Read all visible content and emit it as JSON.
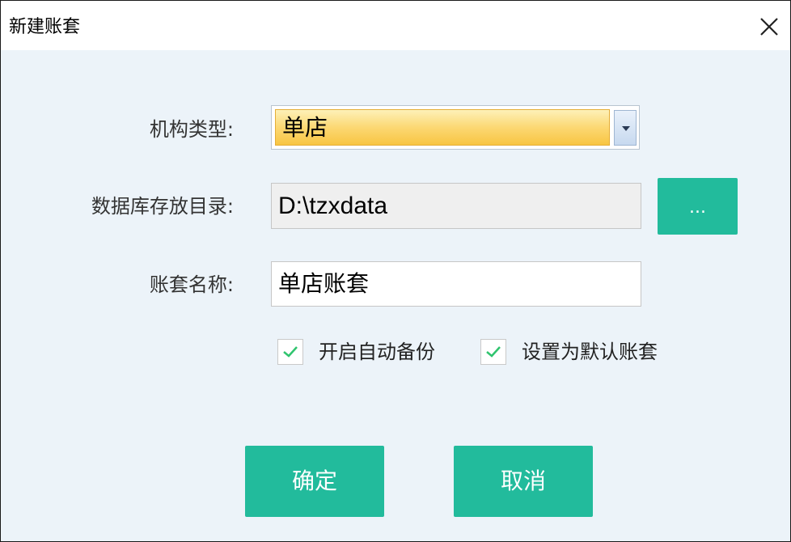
{
  "window": {
    "title": "新建账套",
    "close_icon": "close-icon"
  },
  "form": {
    "org_type": {
      "label": "机构类型:",
      "value": "单店"
    },
    "db_dir": {
      "label": "数据库存放目录:",
      "value": "D:\\tzxdata",
      "browse_label": "..."
    },
    "account_name": {
      "label": "账套名称:",
      "value": "单店账套"
    },
    "options": [
      {
        "label": "开启自动备份",
        "checked": true
      },
      {
        "label": "设置为默认账套",
        "checked": true
      }
    ]
  },
  "buttons": {
    "ok_label": "确定",
    "cancel_label": "取消"
  },
  "colors": {
    "accent": "#22bb9c",
    "background": "#ecf3f9",
    "check": "#2fc46e",
    "combo_highlight": "#fcd873"
  }
}
